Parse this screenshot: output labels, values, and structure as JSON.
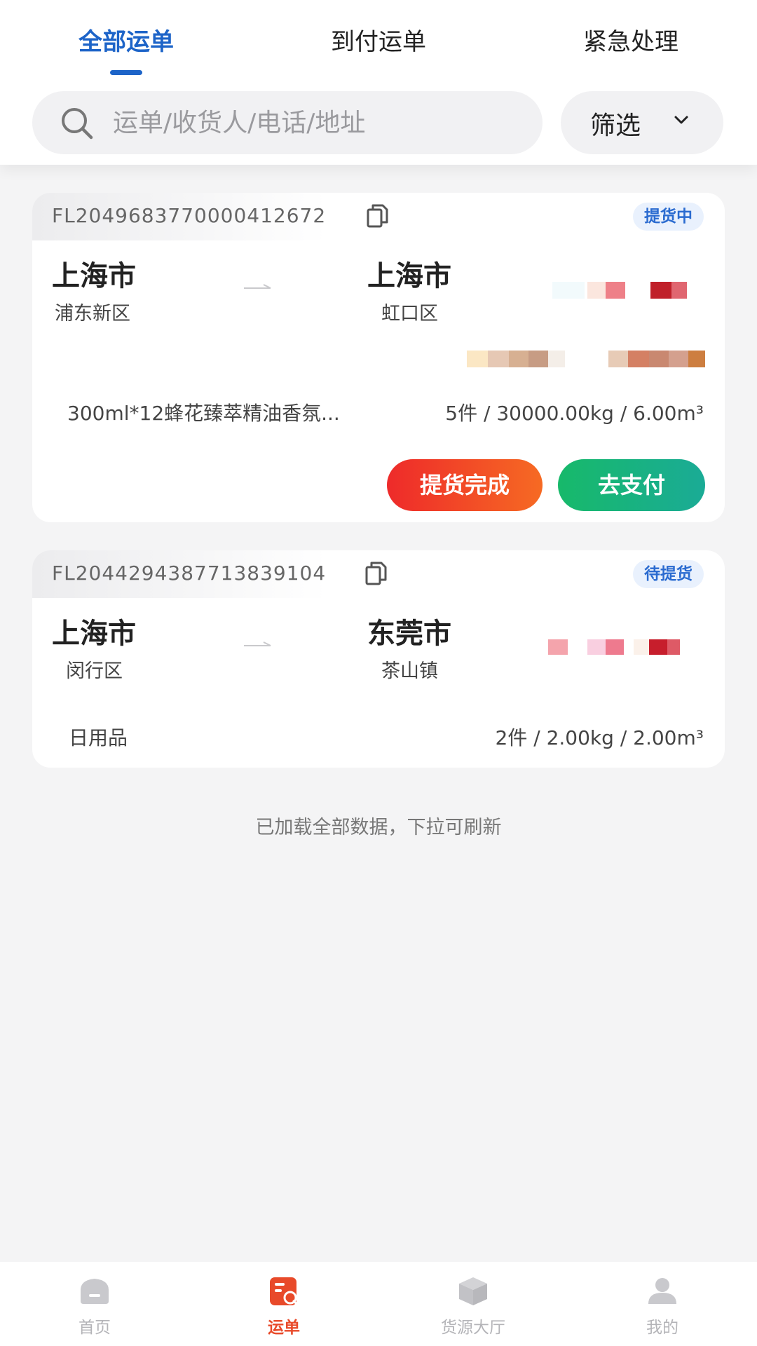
{
  "tabs": [
    {
      "label": "全部运单",
      "active": true
    },
    {
      "label": "到付运单",
      "active": false
    },
    {
      "label": "紧急处理",
      "active": false
    }
  ],
  "search": {
    "placeholder": "运单/收货人/电话/地址",
    "icon": "search-icon"
  },
  "filter": {
    "label": "筛选",
    "icon": "chevron-down-icon"
  },
  "orders": [
    {
      "order_no": "FL2049683770000412672",
      "status": "提货中",
      "origin_city": "上海市",
      "origin_district": "浦东新区",
      "dest_city": "上海市",
      "dest_district": "虹口区",
      "goods": "300ml*12蜂花臻萃精油香氛...",
      "spec": "5件 / 30000.00kg / 6.00m³",
      "actions": [
        "提货完成",
        "去支付"
      ]
    },
    {
      "order_no": "FL2044294387713839104",
      "status": "待提货",
      "origin_city": "上海市",
      "origin_district": "闵行区",
      "dest_city": "东莞市",
      "dest_district": "茶山镇",
      "goods": "日用品",
      "spec": "2件 / 2.00kg / 2.00m³"
    }
  ],
  "footer_note": "已加载全部数据，下拉可刷新",
  "bottom_nav": [
    {
      "label": "首页",
      "icon": "home-icon",
      "active": false
    },
    {
      "label": "运单",
      "icon": "waybill-icon",
      "active": true
    },
    {
      "label": "货源大厅",
      "icon": "cargo-box-icon",
      "active": false
    },
    {
      "label": "我的",
      "icon": "profile-icon",
      "active": false
    }
  ],
  "colors": {
    "primary": "#1d64c8",
    "accent_red": "#ee2a2a",
    "accent_green": "#17b96a",
    "nav_active": "#e84a2a",
    "background": "#f4f4f5"
  }
}
